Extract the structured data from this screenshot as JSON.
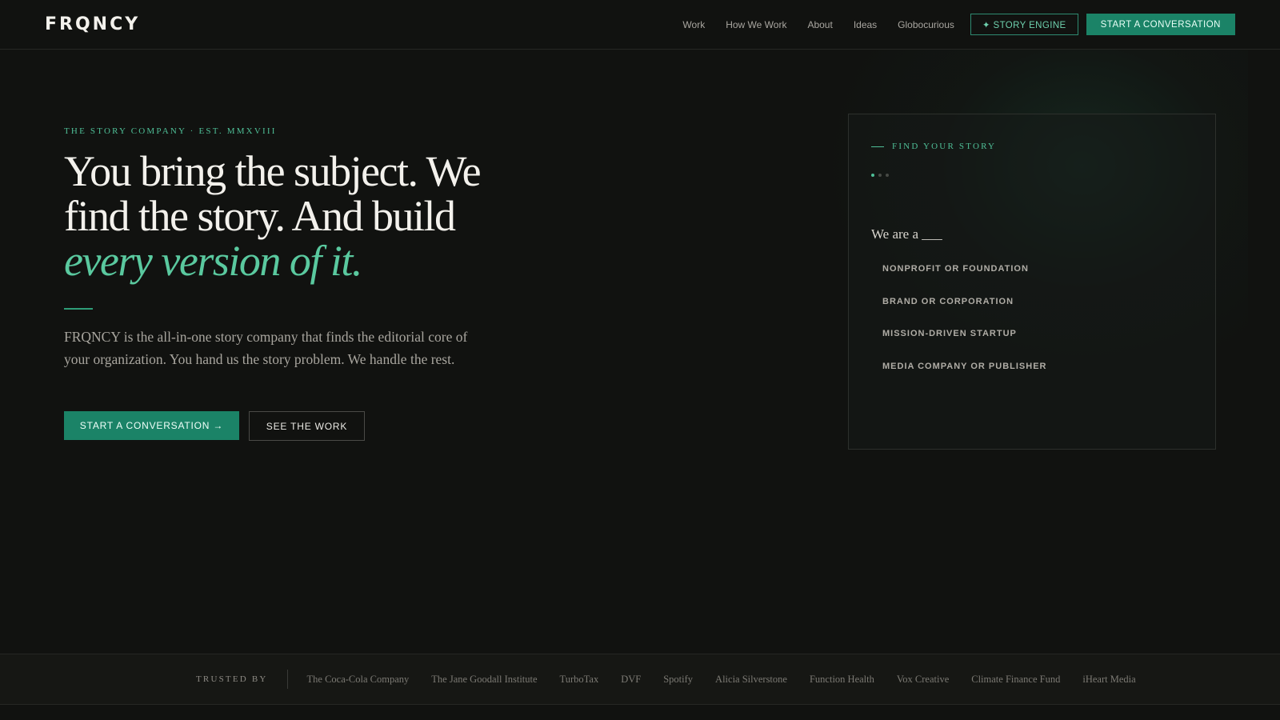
{
  "header": {
    "logo": "FRQNCY",
    "nav": [
      "Work",
      "How We Work",
      "About",
      "Ideas",
      "Globocurious"
    ],
    "story_engine_label": "✦ STORY ENGINE",
    "cta_label": "START A CONVERSATION"
  },
  "hero": {
    "eyebrow": "THE STORY COMPANY · EST. MMXVIII",
    "headline_main": "You bring the subject. We find the story. And build",
    "headline_accent": "every version of it.",
    "lede": "FRQNCY is the all-in-one story company that finds the editorial core of your organization. You hand us the story problem. We handle the rest.",
    "primary_cta": "START A CONVERSATION →",
    "secondary_cta": "SEE THE WORK"
  },
  "card": {
    "kicker": "FIND YOUR STORY",
    "step_count": 3,
    "active_step": 1,
    "prompt": "We are a ___",
    "options": [
      "NONPROFIT OR FOUNDATION",
      "BRAND OR CORPORATION",
      "MISSION-DRIVEN STARTUP",
      "MEDIA COMPANY OR PUBLISHER"
    ]
  },
  "trusted": {
    "label": "TRUSTED BY",
    "clients": [
      "The Coca-Cola Company",
      "The Jane Goodall Institute",
      "TurboTax",
      "DVF",
      "Spotify",
      "Alicia Silverstone",
      "Function Health",
      "Vox Creative",
      "Climate Finance Fund",
      "iHeart Media"
    ]
  },
  "colors": {
    "background": "#111210",
    "accent": "#1b8367",
    "accent_text": "#5ac99f"
  }
}
